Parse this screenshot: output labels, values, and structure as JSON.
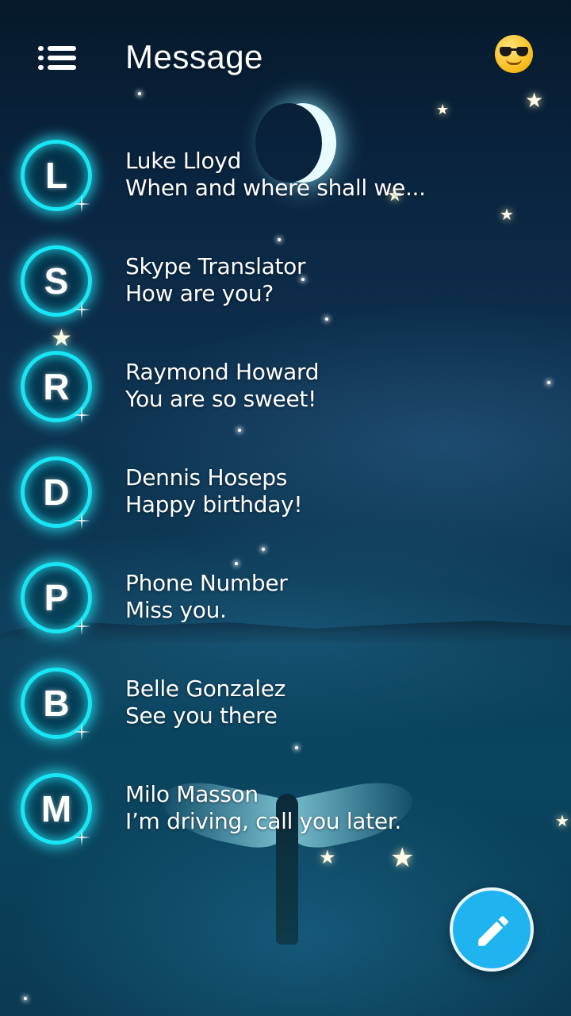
{
  "header": {
    "title": "Message",
    "menu_icon": "hamburger-menu-icon",
    "emoji_icon": "sunglasses-face-emoji"
  },
  "conversations": [
    {
      "initial": "L",
      "name": "Luke Lloyd",
      "preview": "When and where shall we..."
    },
    {
      "initial": "S",
      "name": "Skype Translator",
      "preview": "How are you?"
    },
    {
      "initial": "R",
      "name": "Raymond Howard",
      "preview": "You are so sweet!"
    },
    {
      "initial": "D",
      "name": "Dennis Hoseps",
      "preview": "Happy birthday!"
    },
    {
      "initial": "P",
      "name": "Phone Number",
      "preview": "Miss you."
    },
    {
      "initial": "B",
      "name": "Belle Gonzalez",
      "preview": "See you there"
    },
    {
      "initial": "M",
      "name": "Milo Masson",
      "preview": "I’m driving, call you later."
    }
  ],
  "compose": {
    "icon": "pencil-icon",
    "color": "#1fb3ef"
  },
  "theme": {
    "avatar_ring": "#19e6f5",
    "text": "#ffffff"
  }
}
